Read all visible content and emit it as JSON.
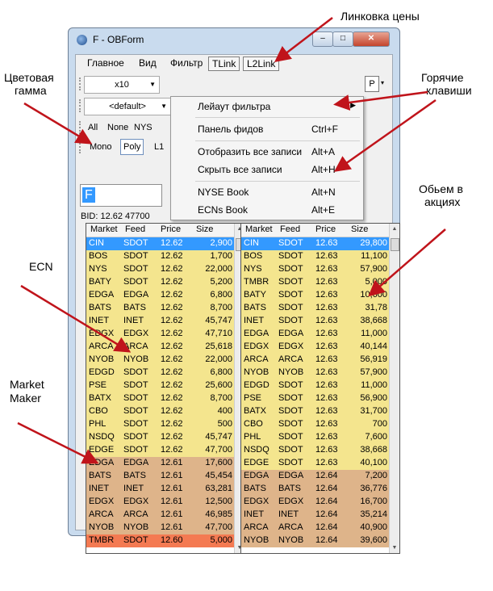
{
  "window": {
    "title": "F - OBForm",
    "min_glyph": "–",
    "max_glyph": "□",
    "close_glyph": "✕"
  },
  "menu": {
    "items": [
      "Главное",
      "Вид",
      "Фильтр"
    ],
    "tabs": [
      "TLink",
      "L2Link"
    ]
  },
  "toolbar": {
    "multiplier": "x10",
    "preset": "<default>",
    "all": "All",
    "none": "None",
    "nys": "NYS",
    "mono": "Mono",
    "poly": "Poly",
    "l1": "L1",
    "p": "P"
  },
  "symbol": {
    "value": "F"
  },
  "bid_line": "BID:  12.62  47700",
  "dropdown": [
    {
      "label": "Лейаут фильтра",
      "key": "",
      "submenu": true
    },
    {
      "label": "Панель фидов",
      "key": "Ctrl+F"
    },
    {
      "label": "Отобразить все записи",
      "key": "Alt+A"
    },
    {
      "label": "Скрыть все записи",
      "key": "Alt+H"
    },
    {
      "label": "NYSE Book",
      "key": "Alt+N"
    },
    {
      "label": "ECNs Book",
      "key": "Alt+E"
    }
  ],
  "columns": [
    "Market",
    "Feed",
    "Price",
    "Size"
  ],
  "colors": {
    "selected": "#3399ff",
    "yellow": "#f4e58e",
    "brown": "#deb48a",
    "red": "#f47a52"
  },
  "left_rows": [
    {
      "m": "CIN",
      "f": "SDOT",
      "p": "12.62",
      "s": "2,900",
      "c": "selected"
    },
    {
      "m": "BOS",
      "f": "SDOT",
      "p": "12.62",
      "s": "1,700",
      "c": "yellow"
    },
    {
      "m": "NYS",
      "f": "SDOT",
      "p": "12.62",
      "s": "22,000",
      "c": "yellow"
    },
    {
      "m": "BATY",
      "f": "SDOT",
      "p": "12.62",
      "s": "5,200",
      "c": "yellow"
    },
    {
      "m": "EDGA",
      "f": "EDGA",
      "p": "12.62",
      "s": "6,800",
      "c": "yellow"
    },
    {
      "m": "BATS",
      "f": "BATS",
      "p": "12.62",
      "s": "8,700",
      "c": "yellow"
    },
    {
      "m": "INET",
      "f": "INET",
      "p": "12.62",
      "s": "45,747",
      "c": "yellow"
    },
    {
      "m": "EDGX",
      "f": "EDGX",
      "p": "12.62",
      "s": "47,710",
      "c": "yellow"
    },
    {
      "m": "ARCA",
      "f": "ARCA",
      "p": "12.62",
      "s": "25,618",
      "c": "yellow"
    },
    {
      "m": "NYOB",
      "f": "NYOB",
      "p": "12.62",
      "s": "22,000",
      "c": "yellow"
    },
    {
      "m": "EDGD",
      "f": "SDOT",
      "p": "12.62",
      "s": "6,800",
      "c": "yellow"
    },
    {
      "m": "PSE",
      "f": "SDOT",
      "p": "12.62",
      "s": "25,600",
      "c": "yellow"
    },
    {
      "m": "BATX",
      "f": "SDOT",
      "p": "12.62",
      "s": "8,700",
      "c": "yellow"
    },
    {
      "m": "CBO",
      "f": "SDOT",
      "p": "12.62",
      "s": "400",
      "c": "yellow"
    },
    {
      "m": "PHL",
      "f": "SDOT",
      "p": "12.62",
      "s": "500",
      "c": "yellow"
    },
    {
      "m": "NSDQ",
      "f": "SDOT",
      "p": "12.62",
      "s": "45,747",
      "c": "yellow"
    },
    {
      "m": "EDGE",
      "f": "SDOT",
      "p": "12.62",
      "s": "47,700",
      "c": "yellow"
    },
    {
      "m": "EDGA",
      "f": "EDGA",
      "p": "12.61",
      "s": "17,600",
      "c": "brown"
    },
    {
      "m": "BATS",
      "f": "BATS",
      "p": "12.61",
      "s": "45,454",
      "c": "brown"
    },
    {
      "m": "INET",
      "f": "INET",
      "p": "12.61",
      "s": "63,281",
      "c": "brown"
    },
    {
      "m": "EDGX",
      "f": "EDGX",
      "p": "12.61",
      "s": "12,500",
      "c": "brown"
    },
    {
      "m": "ARCA",
      "f": "ARCA",
      "p": "12.61",
      "s": "46,985",
      "c": "brown"
    },
    {
      "m": "NYOB",
      "f": "NYOB",
      "p": "12.61",
      "s": "47,700",
      "c": "brown"
    },
    {
      "m": "TMBR",
      "f": "SDOT",
      "p": "12.60",
      "s": "5,000",
      "c": "red"
    }
  ],
  "right_rows": [
    {
      "m": "CIN",
      "f": "SDOT",
      "p": "12.63",
      "s": "29,800",
      "c": "selected"
    },
    {
      "m": "BOS",
      "f": "SDOT",
      "p": "12.63",
      "s": "11,100",
      "c": "yellow"
    },
    {
      "m": "NYS",
      "f": "SDOT",
      "p": "12.63",
      "s": "57,900",
      "c": "yellow"
    },
    {
      "m": "TMBR",
      "f": "SDOT",
      "p": "12.63",
      "s": "5,000",
      "c": "yellow"
    },
    {
      "m": "BATY",
      "f": "SDOT",
      "p": "12.63",
      "s": "10,600",
      "c": "yellow"
    },
    {
      "m": "BATS",
      "f": "SDOT",
      "p": "12.63",
      "s": "31,78",
      "c": "yellow"
    },
    {
      "m": "INET",
      "f": "SDOT",
      "p": "12.63",
      "s": "38,668",
      "c": "yellow"
    },
    {
      "m": "EDGA",
      "f": "EDGA",
      "p": "12.63",
      "s": "11,000",
      "c": "yellow"
    },
    {
      "m": "EDGX",
      "f": "EDGX",
      "p": "12.63",
      "s": "40,144",
      "c": "yellow"
    },
    {
      "m": "ARCA",
      "f": "ARCA",
      "p": "12.63",
      "s": "56,919",
      "c": "yellow"
    },
    {
      "m": "NYOB",
      "f": "NYOB",
      "p": "12.63",
      "s": "57,900",
      "c": "yellow"
    },
    {
      "m": "EDGD",
      "f": "SDOT",
      "p": "12.63",
      "s": "11,000",
      "c": "yellow"
    },
    {
      "m": "PSE",
      "f": "SDOT",
      "p": "12.63",
      "s": "56,900",
      "c": "yellow"
    },
    {
      "m": "BATX",
      "f": "SDOT",
      "p": "12.63",
      "s": "31,700",
      "c": "yellow"
    },
    {
      "m": "CBO",
      "f": "SDOT",
      "p": "12.63",
      "s": "700",
      "c": "yellow"
    },
    {
      "m": "PHL",
      "f": "SDOT",
      "p": "12.63",
      "s": "7,600",
      "c": "yellow"
    },
    {
      "m": "NSDQ",
      "f": "SDOT",
      "p": "12.63",
      "s": "38,668",
      "c": "yellow"
    },
    {
      "m": "EDGE",
      "f": "SDOT",
      "p": "12.63",
      "s": "40,100",
      "c": "yellow"
    },
    {
      "m": "EDGA",
      "f": "EDGA",
      "p": "12.64",
      "s": "7,200",
      "c": "brown"
    },
    {
      "m": "BATS",
      "f": "BATS",
      "p": "12.64",
      "s": "36,776",
      "c": "brown"
    },
    {
      "m": "EDGX",
      "f": "EDGX",
      "p": "12.64",
      "s": "16,700",
      "c": "brown"
    },
    {
      "m": "INET",
      "f": "INET",
      "p": "12.64",
      "s": "35,214",
      "c": "brown"
    },
    {
      "m": "ARCA",
      "f": "ARCA",
      "p": "12.64",
      "s": "40,900",
      "c": "brown"
    },
    {
      "m": "NYOB",
      "f": "NYOB",
      "p": "12.64",
      "s": "39,600",
      "c": "brown"
    }
  ],
  "annotations": {
    "price_link": "Линковка цены",
    "hotkeys_1": "Горячие",
    "hotkeys_2": "клавиши",
    "color_scheme_1": "Цветовая",
    "color_scheme_2": "гамма",
    "volume_1": "Обьем в",
    "volume_2": "акциях",
    "ecn": "ECN",
    "mm_1": "Market",
    "mm_2": "Maker"
  }
}
